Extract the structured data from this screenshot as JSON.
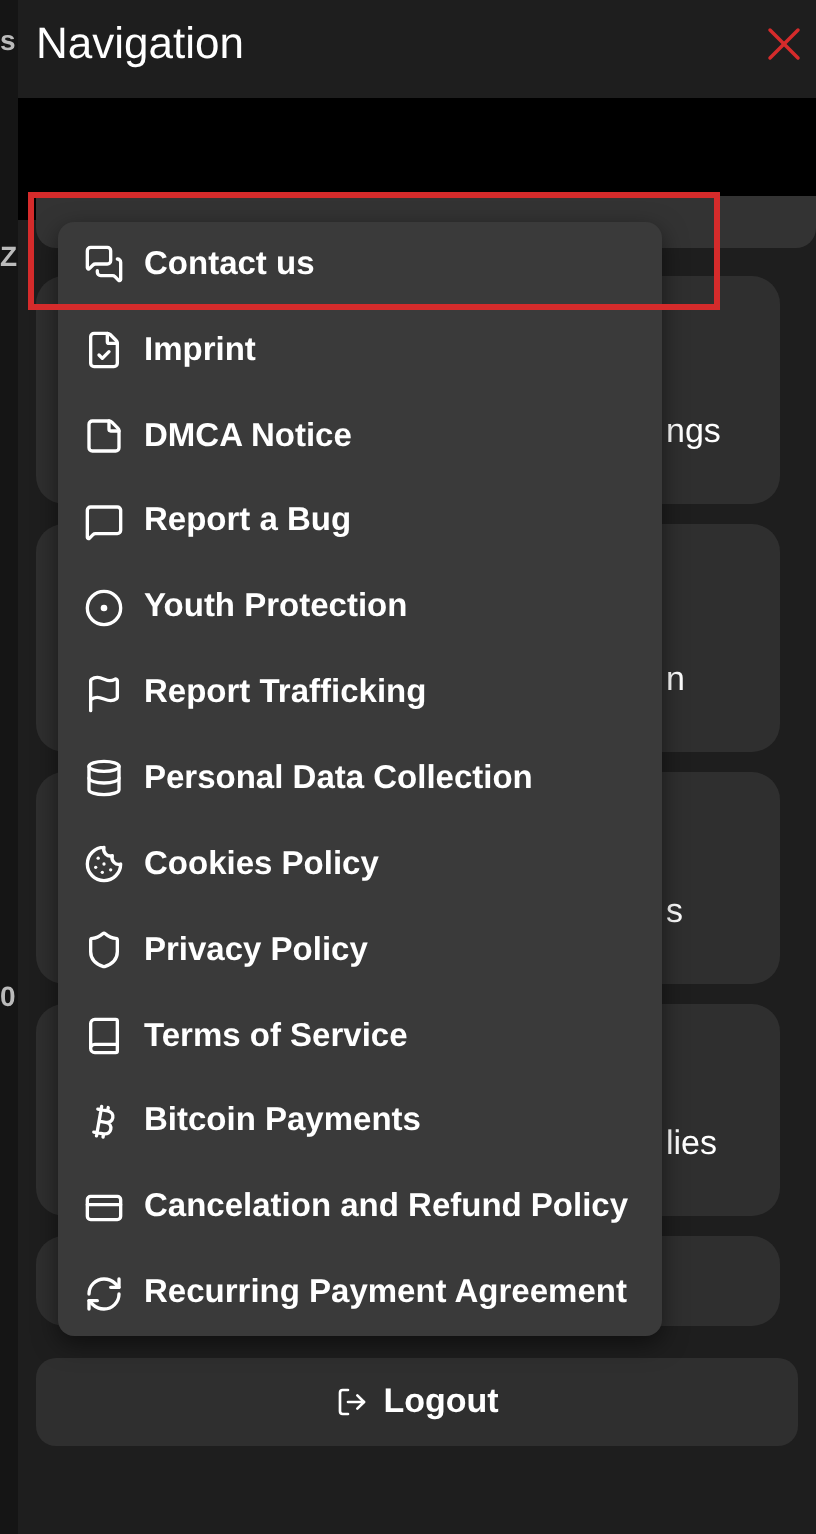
{
  "backdrop_fragments": [
    "s",
    "Z",
    "0"
  ],
  "header": {
    "title": "Navigation"
  },
  "tiles": [
    {
      "label": "ngs"
    },
    {
      "label": "n"
    },
    {
      "label": "s"
    },
    {
      "label": "lies"
    }
  ],
  "logout": {
    "label": "Logout"
  },
  "menu": {
    "items": [
      {
        "label": "Contact us",
        "highlighted": true
      },
      {
        "label": "Imprint",
        "highlighted": false
      },
      {
        "label": "DMCA Notice",
        "highlighted": false
      },
      {
        "label": "Report a Bug",
        "highlighted": false
      },
      {
        "label": "Youth Protection",
        "highlighted": false
      },
      {
        "label": "Report Trafficking",
        "highlighted": false
      },
      {
        "label": "Personal Data Collection",
        "highlighted": false
      },
      {
        "label": "Cookies Policy",
        "highlighted": false
      },
      {
        "label": "Privacy Policy",
        "highlighted": false
      },
      {
        "label": "Terms of Service",
        "highlighted": false
      },
      {
        "label": "Bitcoin Payments",
        "highlighted": false
      },
      {
        "label": "Cancelation and Refund Policy",
        "highlighted": false
      },
      {
        "label": "Recurring Payment Agreement",
        "highlighted": false
      }
    ]
  }
}
